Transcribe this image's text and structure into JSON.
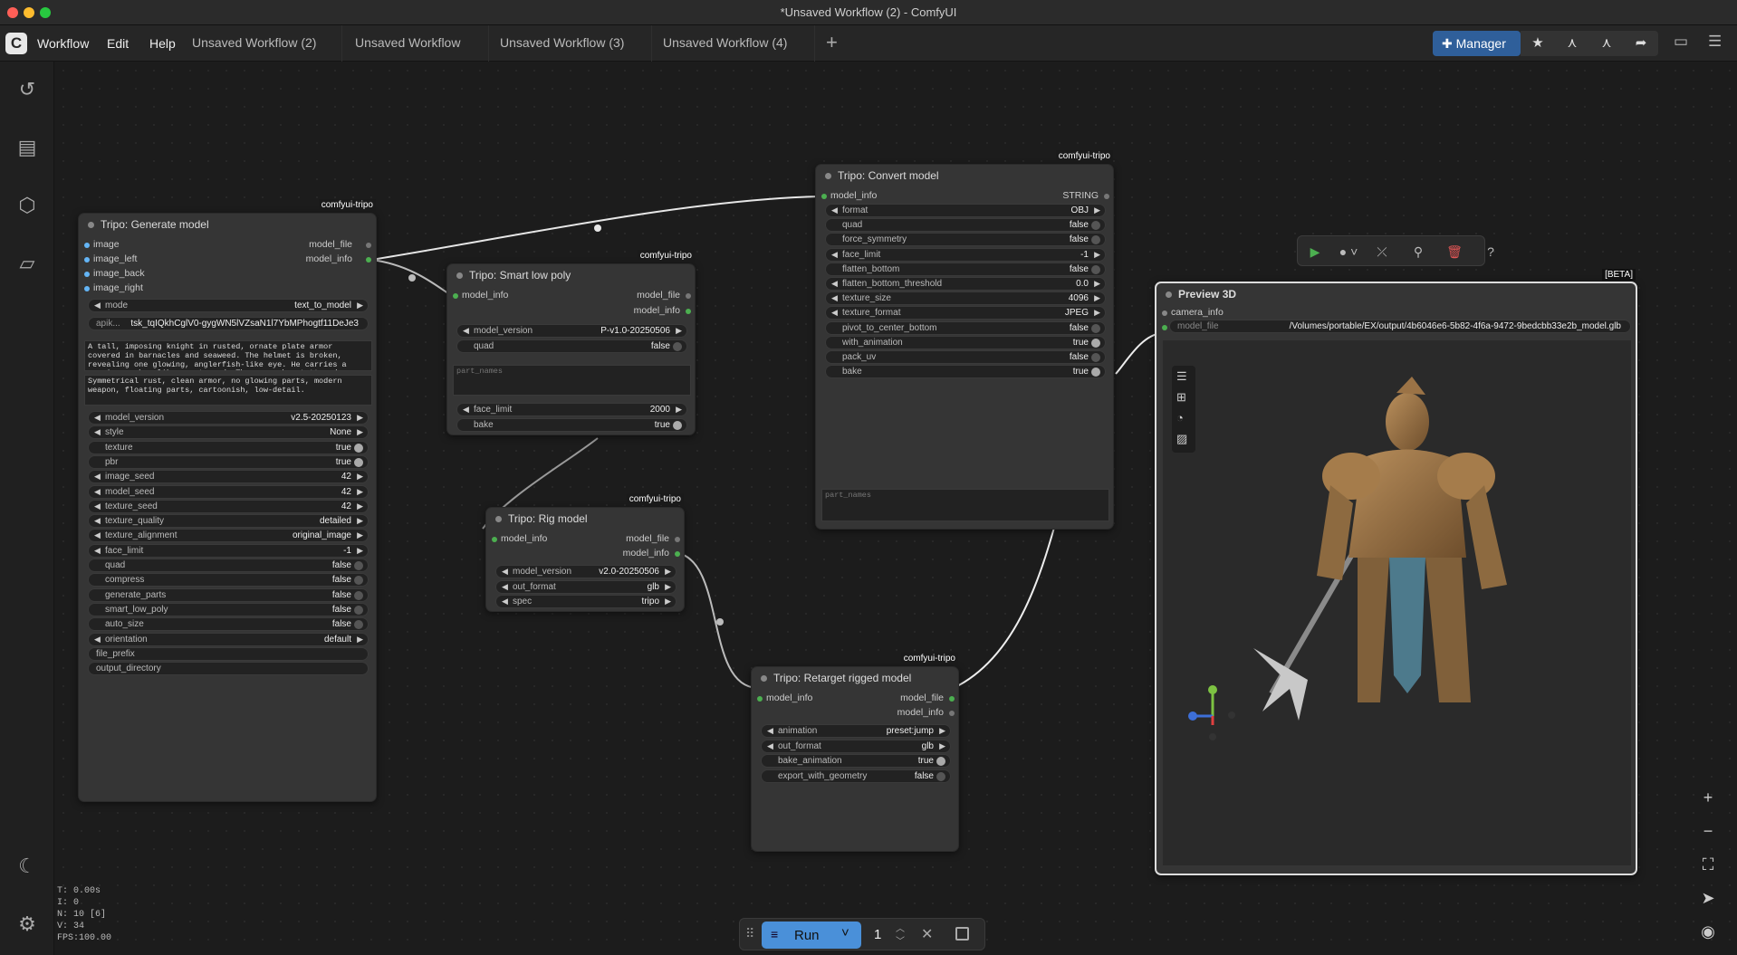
{
  "window": {
    "title": "*Unsaved Workflow (2) - ComfyUI"
  },
  "menu": {
    "logo": "C",
    "items": [
      "Workflow",
      "Edit",
      "Help"
    ]
  },
  "tabs": [
    "Unsaved Workflow (2)",
    "Unsaved Workflow",
    "Unsaved Workflow (3)",
    "Unsaved Workflow (4)"
  ],
  "toolbar": {
    "manager_label": "Manager"
  },
  "nodes": {
    "generate": {
      "title": "Tripo: Generate model",
      "badge": "comfyui-tripo",
      "inputs": [
        "image",
        "image_left",
        "image_back",
        "image_right"
      ],
      "outputs": [
        "model_file",
        "model_info"
      ],
      "mode": {
        "label": "mode",
        "value": "text_to_model"
      },
      "apikey": {
        "label": "apik...",
        "value": "tsk_tqIQkhCglV0-gygWN5lVZsaN1l7YbMPhogtf11DeJe3"
      },
      "prompt": "A tall, imposing knight in rusted, ornate plate armor covered in barnacles and seaweed. The helmet is broken, revealing one glowing, anglerfish-like eye. He carries a massive anchor-like greatsword. The armor has tattered",
      "negative_prompt": "Symmetrical rust, clean armor, no glowing parts, modern weapon, floating parts, cartoonish, low-detail.",
      "widgets": [
        {
          "label": "model_version",
          "value": "v2.5-20250123",
          "kind": "combo"
        },
        {
          "label": "style",
          "value": "None",
          "kind": "combo"
        },
        {
          "label": "texture",
          "value": "true",
          "kind": "toggle"
        },
        {
          "label": "pbr",
          "value": "true",
          "kind": "toggle"
        },
        {
          "label": "image_seed",
          "value": "42",
          "kind": "combo"
        },
        {
          "label": "model_seed",
          "value": "42",
          "kind": "combo"
        },
        {
          "label": "texture_seed",
          "value": "42",
          "kind": "combo"
        },
        {
          "label": "texture_quality",
          "value": "detailed",
          "kind": "combo"
        },
        {
          "label": "texture_alignment",
          "value": "original_image",
          "kind": "combo"
        },
        {
          "label": "face_limit",
          "value": "-1",
          "kind": "combo"
        },
        {
          "label": "quad",
          "value": "false",
          "kind": "toggle"
        },
        {
          "label": "compress",
          "value": "false",
          "kind": "toggle"
        },
        {
          "label": "generate_parts",
          "value": "false",
          "kind": "toggle"
        },
        {
          "label": "smart_low_poly",
          "value": "false",
          "kind": "toggle"
        },
        {
          "label": "auto_size",
          "value": "false",
          "kind": "toggle"
        },
        {
          "label": "orientation",
          "value": "default",
          "kind": "combo"
        },
        {
          "label": "file_prefix",
          "value": "",
          "kind": "text"
        },
        {
          "label": "output_directory",
          "value": "",
          "kind": "text"
        }
      ]
    },
    "smart": {
      "title": "Tripo: Smart low poly",
      "badge": "comfyui-tripo",
      "inputs": [
        "model_info"
      ],
      "outputs": [
        "model_file",
        "model_info"
      ],
      "widgets_top": [
        {
          "label": "model_version",
          "value": "P-v1.0-20250506",
          "kind": "combo"
        },
        {
          "label": "quad",
          "value": "false",
          "kind": "toggle"
        }
      ],
      "part_names": "part_names",
      "widgets_bottom": [
        {
          "label": "face_limit",
          "value": "2000",
          "kind": "combo"
        },
        {
          "label": "bake",
          "value": "true",
          "kind": "toggle"
        }
      ]
    },
    "rig": {
      "title": "Tripo: Rig model",
      "badge": "comfyui-tripo",
      "inputs": [
        "model_info"
      ],
      "outputs": [
        "model_file",
        "model_info"
      ],
      "widgets": [
        {
          "label": "model_version",
          "value": "v2.0-20250506",
          "kind": "combo"
        },
        {
          "label": "out_format",
          "value": "glb",
          "kind": "combo"
        },
        {
          "label": "spec",
          "value": "tripo",
          "kind": "combo"
        }
      ]
    },
    "convert": {
      "title": "Tripo: Convert model",
      "badge": "comfyui-tripo",
      "inputs": [
        "model_info"
      ],
      "outputs": [
        "STRING"
      ],
      "widgets": [
        {
          "label": "format",
          "value": "OBJ",
          "kind": "combo"
        },
        {
          "label": "quad",
          "value": "false",
          "kind": "toggle"
        },
        {
          "label": "force_symmetry",
          "value": "false",
          "kind": "toggle"
        },
        {
          "label": "face_limit",
          "value": "-1",
          "kind": "combo"
        },
        {
          "label": "flatten_bottom",
          "value": "false",
          "kind": "toggle"
        },
        {
          "label": "flatten_bottom_threshold",
          "value": "0.0",
          "kind": "combo"
        },
        {
          "label": "texture_size",
          "value": "4096",
          "kind": "combo"
        },
        {
          "label": "texture_format",
          "value": "JPEG",
          "kind": "combo"
        },
        {
          "label": "pivot_to_center_bottom",
          "value": "false",
          "kind": "toggle"
        },
        {
          "label": "with_animation",
          "value": "true",
          "kind": "toggle"
        },
        {
          "label": "pack_uv",
          "value": "false",
          "kind": "toggle"
        },
        {
          "label": "bake",
          "value": "true",
          "kind": "toggle"
        }
      ],
      "part_names": "part_names"
    },
    "retarget": {
      "title": "Tripo: Retarget rigged model",
      "badge": "comfyui-tripo",
      "inputs": [
        "model_info"
      ],
      "outputs": [
        "model_file",
        "model_info"
      ],
      "widgets": [
        {
          "label": "animation",
          "value": "preset:jump",
          "kind": "combo"
        },
        {
          "label": "out_format",
          "value": "glb",
          "kind": "combo"
        },
        {
          "label": "bake_animation",
          "value": "true",
          "kind": "toggle"
        },
        {
          "label": "export_with_geometry",
          "value": "false",
          "kind": "toggle"
        }
      ]
    },
    "preview": {
      "title": "Preview 3D",
      "badge": "[BETA]",
      "inputs": [
        "camera_info",
        "model_file"
      ],
      "model_file_value": "/Volumes/portable/EX/output/4b6046e6-5b82-4f6a-9472-9bedcbb33e2b_model.glb"
    }
  },
  "stats": [
    "T: 0.00s",
    "I: 0",
    "N: 10 [6]",
    "V: 34",
    "FPS:100.00"
  ],
  "run": {
    "label": "Run",
    "count": "1"
  },
  "colors": {
    "accent": "#2f5f9a",
    "slot_model": "#4caf50",
    "slot_image": "#64b5f6",
    "run": "#4a90d9"
  }
}
